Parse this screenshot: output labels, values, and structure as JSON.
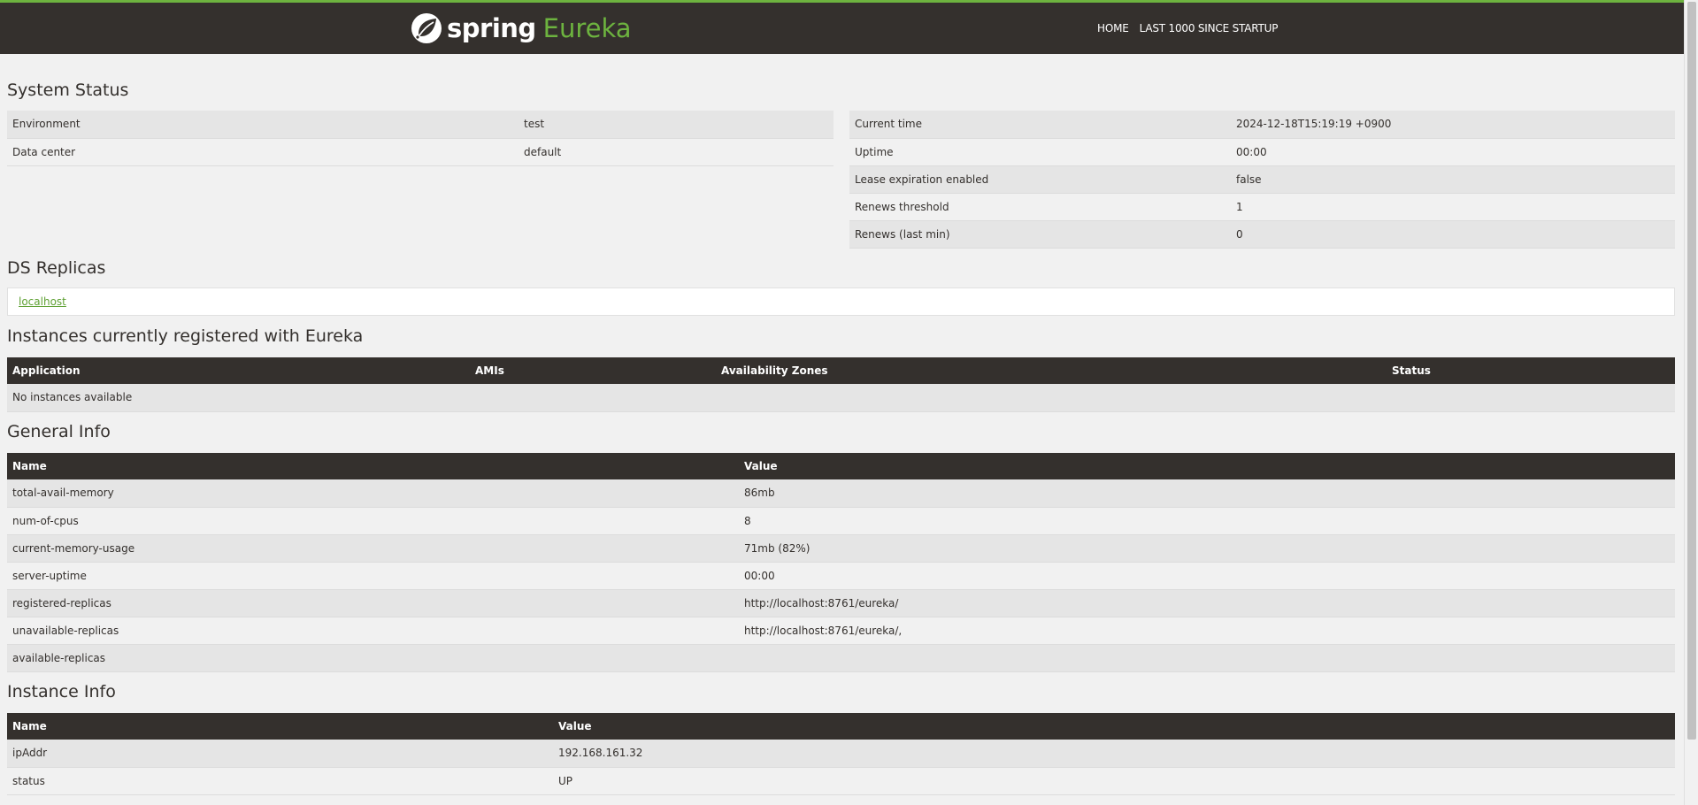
{
  "header": {
    "brand_spring": "spring",
    "brand_eureka": "Eureka",
    "nav": [
      {
        "label": "HOME"
      },
      {
        "label": "LAST 1000 SINCE STARTUP"
      }
    ]
  },
  "system_status": {
    "title": "System Status",
    "left": [
      {
        "label": "Environment",
        "value": "test"
      },
      {
        "label": "Data center",
        "value": "default"
      }
    ],
    "right": [
      {
        "label": "Current time",
        "value": "2024-12-18T15:19:19 +0900"
      },
      {
        "label": "Uptime",
        "value": "00:00"
      },
      {
        "label": "Lease expiration enabled",
        "value": "false"
      },
      {
        "label": "Renews threshold",
        "value": "1"
      },
      {
        "label": "Renews (last min)",
        "value": "0"
      }
    ]
  },
  "ds_replicas": {
    "title": "DS Replicas",
    "link": "localhost"
  },
  "instances": {
    "title": "Instances currently registered with Eureka",
    "columns": [
      "Application",
      "AMIs",
      "Availability Zones",
      "Status"
    ],
    "empty_text": "No instances available"
  },
  "general_info": {
    "title": "General Info",
    "columns": [
      "Name",
      "Value"
    ],
    "rows": [
      {
        "name": "total-avail-memory",
        "value": "86mb"
      },
      {
        "name": "num-of-cpus",
        "value": "8"
      },
      {
        "name": "current-memory-usage",
        "value": "71mb (82%)"
      },
      {
        "name": "server-uptime",
        "value": "00:00"
      },
      {
        "name": "registered-replicas",
        "value": "http://localhost:8761/eureka/"
      },
      {
        "name": "unavailable-replicas",
        "value": "http://localhost:8761/eureka/,"
      },
      {
        "name": "available-replicas",
        "value": ""
      }
    ]
  },
  "instance_info": {
    "title": "Instance Info",
    "columns": [
      "Name",
      "Value"
    ],
    "rows": [
      {
        "name": "ipAddr",
        "value": "192.168.161.32"
      },
      {
        "name": "status",
        "value": "UP"
      }
    ]
  },
  "colors": {
    "header_bg": "#34302d",
    "accent_green": "#6db33f",
    "link_green": "#5fa134",
    "page_bg": "#f1f1f1",
    "row_stripe": "#e5e5e5"
  },
  "icons": {
    "brand": "spring-leaf-icon"
  }
}
